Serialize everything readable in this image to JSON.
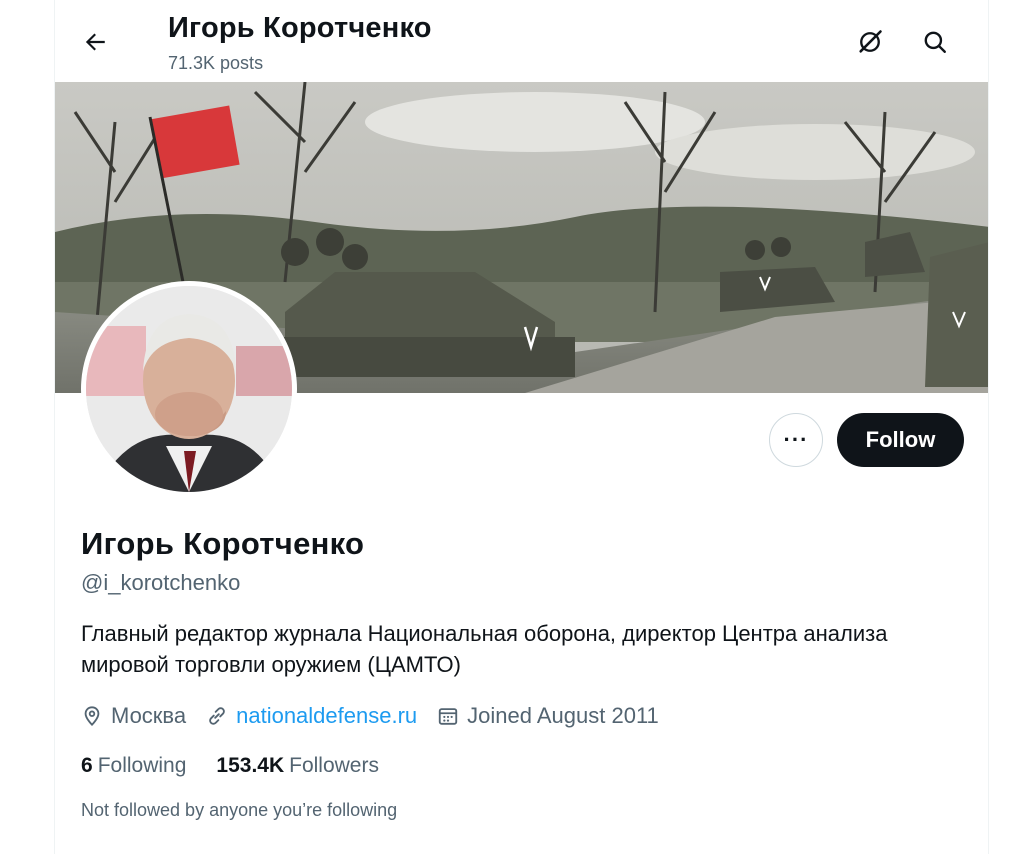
{
  "header": {
    "name": "Игорь Коротченко",
    "posts": "71.3K posts"
  },
  "profile": {
    "display_name": "Игорь Коротченко",
    "handle": "@i_korotchenko",
    "bio": "Главный редактор журнала Национальная оборона, директор Центра анализа мировой торговли оружием (ЦАМТО)",
    "location": "Москва",
    "website": "nationaldefense.ru",
    "joined": "Joined August 2011",
    "following_count": "6",
    "following_label": "Following",
    "followers_count": "153.4K",
    "followers_label": "Followers",
    "follow_note": "Not followed by anyone you’re following"
  },
  "actions": {
    "more_label": "···",
    "follow_label": "Follow"
  },
  "icons": [
    "back-arrow-icon",
    "grok-icon",
    "search-icon",
    "location-icon",
    "link-icon",
    "calendar-icon"
  ],
  "colors": {
    "text": "#0f1419",
    "secondary": "#536471",
    "link": "#1d9bf0",
    "follow_bg": "#0f1419"
  }
}
